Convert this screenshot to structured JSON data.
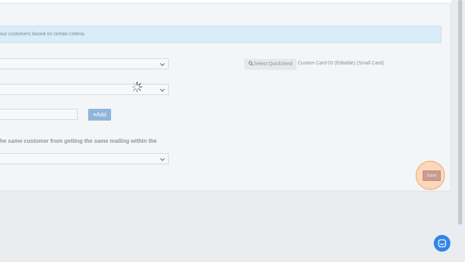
{
  "info_banner": {
    "text": "our customers based on certain criteria."
  },
  "quicksend": {
    "button_label": "Select QuickSend",
    "card_name": "Custom Card 03 (Editable) (Small Card)"
  },
  "add_button": {
    "label": "Add"
  },
  "section_heading": {
    "text": "he same customer from getting the same mailing within the"
  },
  "save_button": {
    "label": "Save"
  },
  "icons": {
    "search": "search-icon",
    "plus": "plus-icon",
    "chevron": "chevron-down-icon",
    "spinner": "loading-spinner-icon",
    "chat": "chat-icon"
  },
  "colors": {
    "info_bg": "#d9ecf7",
    "add_button": "#8fb5dc",
    "save_highlight": "#fcd7b8",
    "save_button": "#c99c8f",
    "chat_button": "#2f86e8"
  }
}
